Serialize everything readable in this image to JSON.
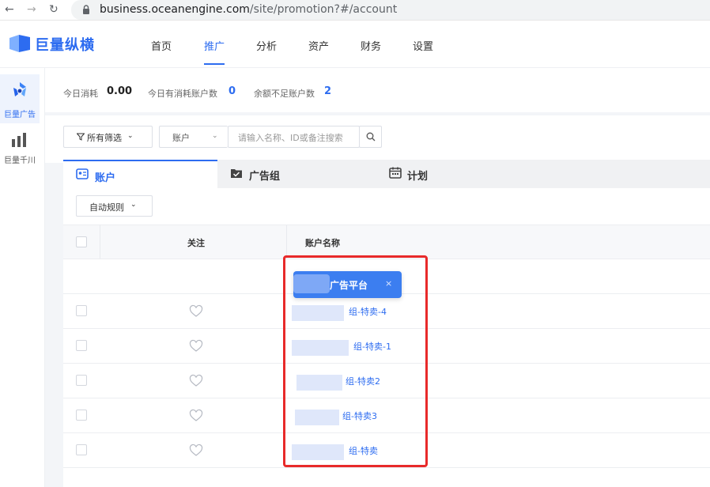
{
  "browser": {
    "url_domain": "business.oceanengine.com",
    "url_path": "/site/promotion?#/account"
  },
  "header": {
    "logo": "巨量纵横",
    "nav": [
      {
        "label": "首页"
      },
      {
        "label": "推广",
        "active": true
      },
      {
        "label": "分析"
      },
      {
        "label": "资产"
      },
      {
        "label": "财务"
      },
      {
        "label": "设置"
      }
    ],
    "accent_color": "#2d6cf0"
  },
  "sidebar": {
    "items": [
      {
        "label": "巨量广告",
        "icon": "ocean-ads-icon",
        "active": true
      },
      {
        "label": "巨量千川",
        "icon": "qianchuan-icon"
      }
    ]
  },
  "stats": {
    "today_spend_label": "今日消耗",
    "today_spend_value": "0.00",
    "accounts_with_spend_label": "今日有消耗账户数",
    "accounts_with_spend_value": "0",
    "low_balance_label": "余额不足账户数",
    "low_balance_value": "2"
  },
  "filters": {
    "all_filters_label": "所有筛选",
    "account_select_label": "账户",
    "search_placeholder": "请输入名称、ID或备注搜索"
  },
  "tabs": [
    {
      "label": "账户",
      "active": true,
      "icon": "account-card-icon"
    },
    {
      "label": "广告组",
      "icon": "folder-check-icon"
    },
    {
      "label": "计划",
      "icon": "calendar-icon"
    }
  ],
  "table": {
    "auto_rule_label": "自动规则",
    "columns": {
      "follow": "关注",
      "account_name": "账户名称"
    },
    "rows": [
      {
        "account_name": "组-特卖-4"
      },
      {
        "account_name": "组-特卖-1"
      },
      {
        "account_name": "组-特卖2"
      },
      {
        "account_name": "组-特卖3"
      },
      {
        "account_name": "组-特卖"
      }
    ]
  },
  "tooltip": {
    "text": "广告平台",
    "close": "×"
  }
}
